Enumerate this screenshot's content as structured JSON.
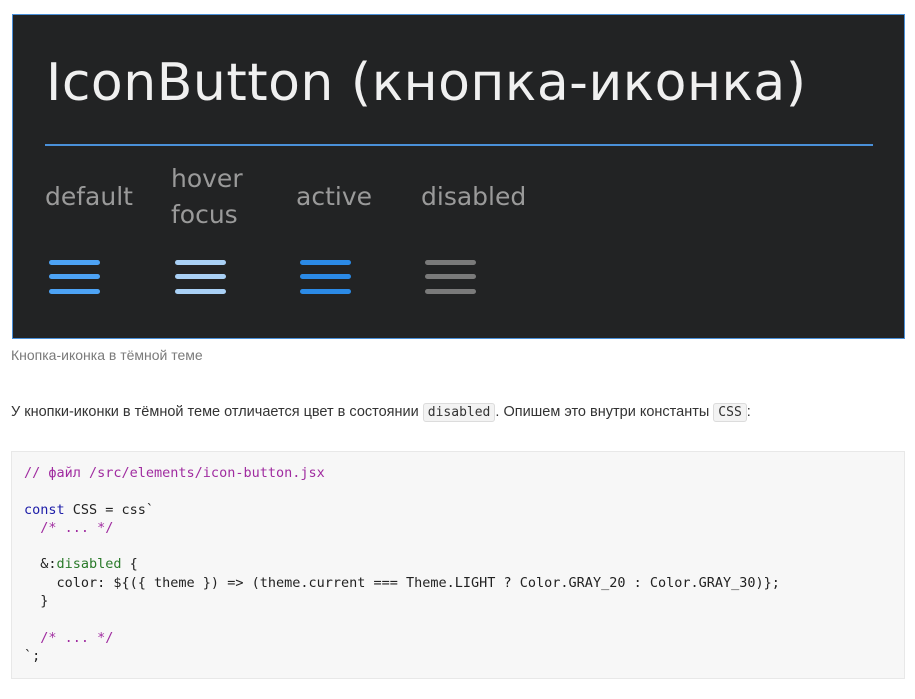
{
  "preview": {
    "title": "IconButton (кнопка-иконка)",
    "states": [
      {
        "label_line1": "default",
        "label_line2": "",
        "color": "#4da3f5"
      },
      {
        "label_line1": "hover",
        "label_line2": "focus",
        "color": "#a9d0f5"
      },
      {
        "label_line1": "active",
        "label_line2": "",
        "color": "#2b8ae6"
      },
      {
        "label_line1": "disabled",
        "label_line2": "",
        "color": "#7a7a7a"
      }
    ],
    "icon": "menu-icon",
    "accent_color": "#4a90d9",
    "background_color": "#222324"
  },
  "caption": "Кнопка-иконка в тёмной теме",
  "paragraph": {
    "part1": "У кнопки-иконки в тёмной теме отличается цвет в состоянии ",
    "code1": "disabled",
    "part2": ". Опишем это внутри константы ",
    "code2": "CSS",
    "part3": ":"
  },
  "code": {
    "line1": "// файл /src/elements/icon-button.jsx",
    "line3_kw": "const",
    "line3_rest": " CSS = css`",
    "line4": "  /* ... */",
    "line6_pre": "  &:",
    "line6_attr": "disabled",
    "line6_post": " {",
    "line7": "    color: ${({ theme }) => (theme.current === Theme.LIGHT ? Color.GRAY_20 : Color.GRAY_30)};",
    "line8": "  }",
    "line10": "  /* ... */",
    "line11": "`;"
  }
}
